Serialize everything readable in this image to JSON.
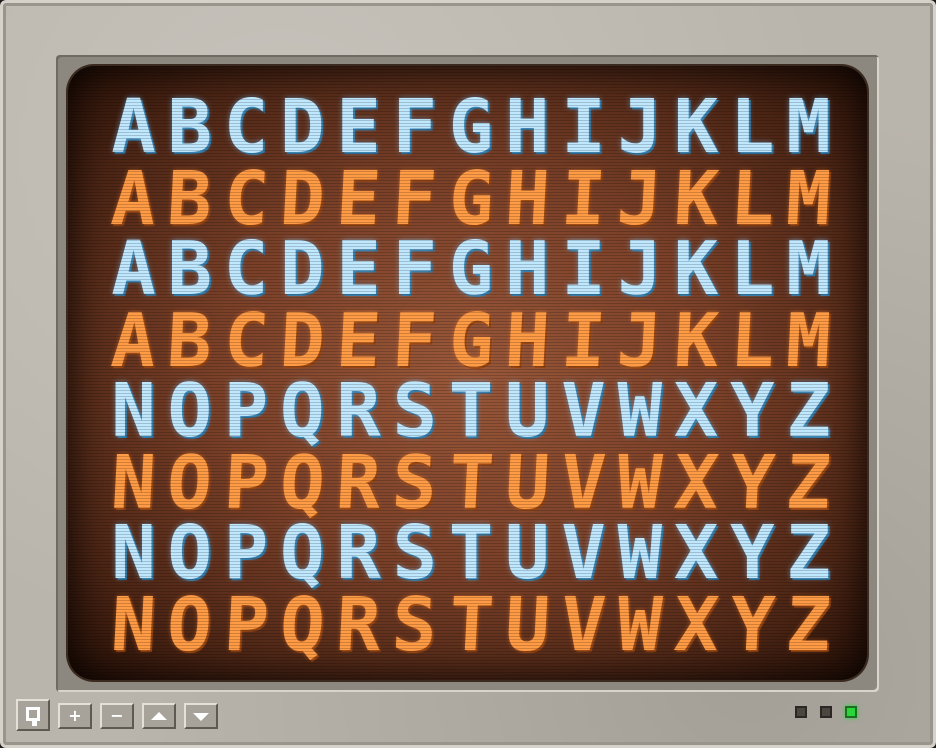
{
  "rows": [
    {
      "style": "blue",
      "chars": [
        "A",
        "B",
        "C",
        "D",
        "E",
        "F",
        "G",
        "H",
        "I",
        "J",
        "K",
        "L",
        "M"
      ]
    },
    {
      "style": "orange",
      "chars": [
        "A",
        "B",
        "C",
        "D",
        "E",
        "F",
        "G",
        "H",
        "I",
        "J",
        "K",
        "L",
        "M"
      ]
    },
    {
      "style": "blue",
      "chars": [
        "A",
        "B",
        "C",
        "D",
        "E",
        "F",
        "G",
        "H",
        "I",
        "J",
        "K",
        "L",
        "M"
      ]
    },
    {
      "style": "orange",
      "chars": [
        "A",
        "B",
        "C",
        "D",
        "E",
        "F",
        "G",
        "H",
        "I",
        "J",
        "K",
        "L",
        "M"
      ]
    },
    {
      "style": "blue",
      "chars": [
        "N",
        "O",
        "P",
        "Q",
        "R",
        "S",
        "T",
        "U",
        "V",
        "W",
        "X",
        "Y",
        "Z"
      ]
    },
    {
      "style": "orange",
      "chars": [
        "N",
        "O",
        "P",
        "Q",
        "R",
        "S",
        "T",
        "U",
        "V",
        "W",
        "X",
        "Y",
        "Z"
      ]
    },
    {
      "style": "blue",
      "chars": [
        "N",
        "O",
        "P",
        "Q",
        "R",
        "S",
        "T",
        "U",
        "V",
        "W",
        "X",
        "Y",
        "Z"
      ]
    },
    {
      "style": "orange",
      "chars": [
        "N",
        "O",
        "P",
        "Q",
        "R",
        "S",
        "T",
        "U",
        "V",
        "W",
        "X",
        "Y",
        "Z"
      ]
    }
  ],
  "controls": {
    "monitor_icon": "monitor-icon",
    "plus_label": "+",
    "minus_label": "−",
    "up_icon": "triangle-up-icon",
    "down_icon": "triangle-down-icon"
  },
  "leds": [
    {
      "name": "led-1",
      "on": false
    },
    {
      "name": "led-2",
      "on": false
    },
    {
      "name": "led-3",
      "on": true,
      "color": "#2bd63a"
    }
  ],
  "colors": {
    "glyph_blue": "#bfe8ff",
    "glyph_orange": "#ff9a45",
    "screen_bg": "#7a4028",
    "bezel": "#bab5ac"
  }
}
